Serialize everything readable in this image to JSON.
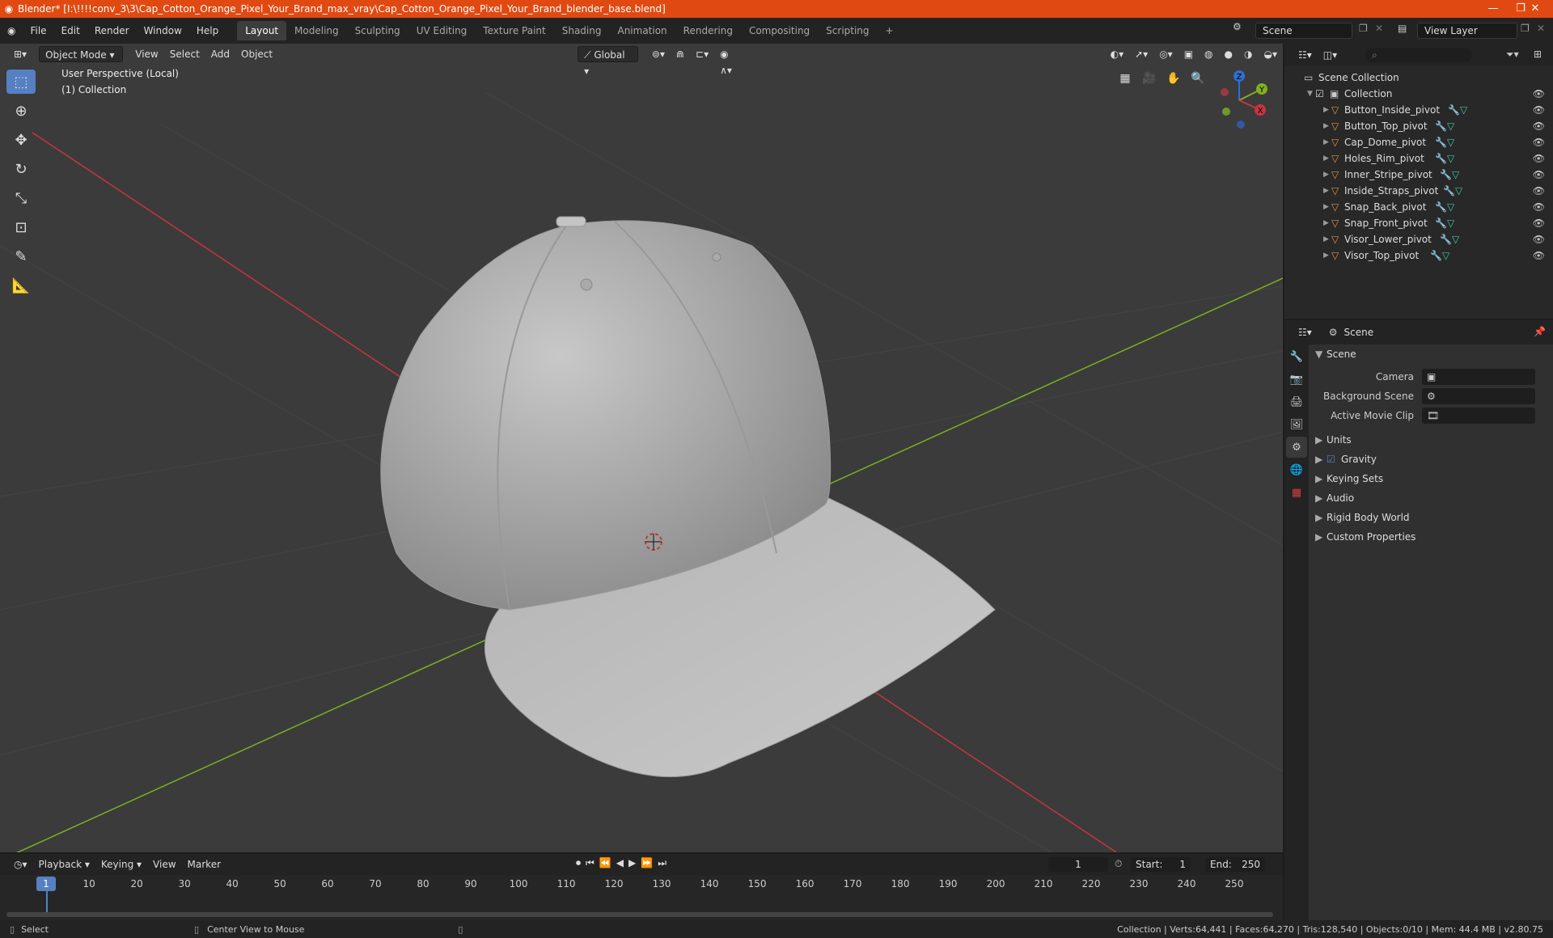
{
  "titlebar": {
    "title": "Blender* [I:\\!!!!conv_3\\3\\Cap_Cotton_Orange_Pixel_Your_Brand_max_vray\\Cap_Cotton_Orange_Pixel_Your_Brand_blender_base.blend]",
    "minimize": "—",
    "maximize": "❐",
    "close": "✕"
  },
  "menu": [
    "File",
    "Edit",
    "Render",
    "Window",
    "Help"
  ],
  "workspaces": [
    "Layout",
    "Modeling",
    "Sculpting",
    "UV Editing",
    "Texture Paint",
    "Shading",
    "Animation",
    "Rendering",
    "Compositing",
    "Scripting"
  ],
  "workspace_add": "+",
  "scene_name": "Scene",
  "view_layer": "View Layer",
  "viewport": {
    "mode": "Object Mode",
    "menus": [
      "View",
      "Select",
      "Add",
      "Object"
    ],
    "transform_orientation": "Global",
    "perspective_label": "User Perspective (Local)",
    "collection_label": "(1) Collection",
    "gizmo_axes": {
      "x": "X",
      "y": "Y",
      "z": "Z"
    }
  },
  "outliner": {
    "search_placeholder": "",
    "root": "Scene Collection",
    "collection": "Collection",
    "objects": [
      "Button_Inside_pivot",
      "Button_Top_pivot",
      "Cap_Dome_pivot",
      "Holes_Rim_pivot",
      "Inner_Stripe_pivot",
      "Inside_Straps_pivot",
      "Snap_Back_pivot",
      "Snap_Front_pivot",
      "Visor_Lower_pivot",
      "Visor_Top_pivot"
    ]
  },
  "properties": {
    "context": "Scene",
    "section": "Scene",
    "fields": [
      {
        "label": "Camera",
        "value": ""
      },
      {
        "label": "Background Scene",
        "value": ""
      },
      {
        "label": "Active Movie Clip",
        "value": ""
      }
    ],
    "panels": [
      "Units",
      "Gravity",
      "Keying Sets",
      "Audio",
      "Rigid Body World",
      "Custom Properties"
    ]
  },
  "timeline": {
    "menus": [
      "Playback",
      "Keying",
      "View",
      "Marker"
    ],
    "current_frame": "1",
    "start_label": "Start:",
    "start": "1",
    "end_label": "End:",
    "end": "250",
    "ticks": [
      "1",
      "10",
      "20",
      "30",
      "40",
      "50",
      "60",
      "70",
      "80",
      "90",
      "100",
      "110",
      "120",
      "130",
      "140",
      "150",
      "160",
      "170",
      "180",
      "190",
      "200",
      "210",
      "220",
      "230",
      "240",
      "250"
    ]
  },
  "statusbar": {
    "select": "Select",
    "center_view": "Center View to Mouse",
    "stats": "Collection | Verts:64,441 | Faces:64,270 | Tris:128,540 | Objects:0/10 | Mem: 44.4 MB | v2.80.75"
  },
  "colors": {
    "title_bg": "#e04a12",
    "accent": "#5680c2",
    "mesh_icon": "#e8903c",
    "data_icon": "#3fc9a5",
    "x_axis": "#c8343f",
    "y_axis": "#7fb01f"
  }
}
